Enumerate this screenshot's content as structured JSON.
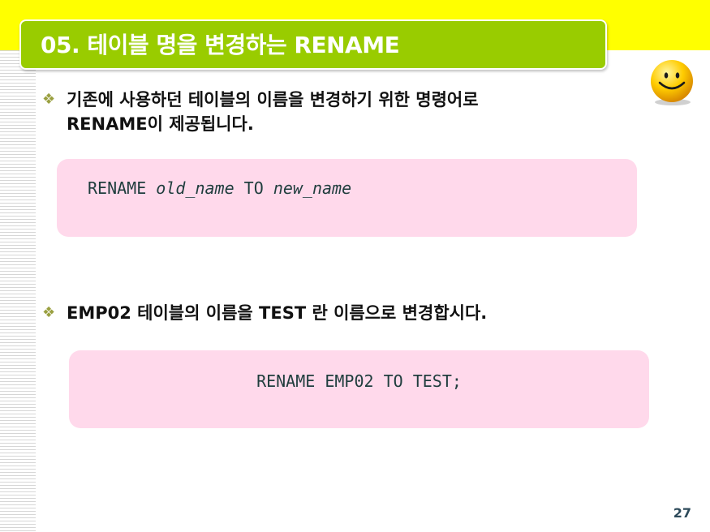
{
  "slide": {
    "title": "05. 테이블 명을 변경하는 RENAME",
    "bullet_mark": "❖",
    "bullets": [
      {
        "line1": "기존에 사용하던 테이블의 이름을 변경하기 위한 명령어로",
        "line2": "RENAME이 제공됩니다."
      },
      {
        "text": "EMP02 테이블의 이름을 TEST 란 이름으로 변경합시다."
      }
    ],
    "syntax": {
      "kw_rename": "RENAME",
      "old_name": "old_name",
      "kw_to": "TO",
      "new_name": "new_name"
    },
    "example": "RENAME EMP02 TO TEST;",
    "page_number": "27",
    "colors": {
      "title_bar": "#99cc00",
      "top_band": "#ffff00",
      "code_box": "#ffd9eb"
    },
    "icons": [
      "smiley-face-icon"
    ]
  }
}
